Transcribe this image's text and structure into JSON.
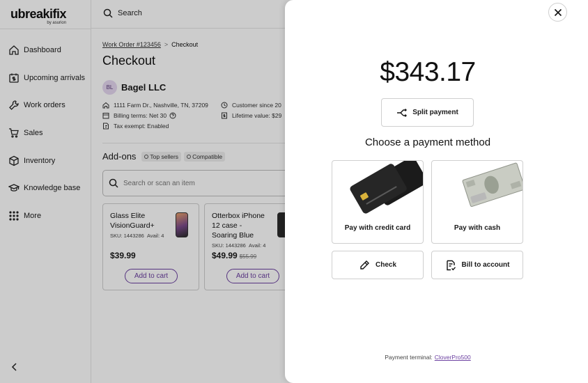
{
  "app": {
    "logo": "ubreakifix",
    "logo_sub": "by asurion",
    "search_label": "Search"
  },
  "sidebar": {
    "items": [
      {
        "label": "Dashboard",
        "icon": "home-icon"
      },
      {
        "label": "Upcoming arrivals",
        "icon": "calendar-dollar-icon"
      },
      {
        "label": "Work orders",
        "icon": "wrench-icon"
      },
      {
        "label": "Sales",
        "icon": "cart-icon"
      },
      {
        "label": "Inventory",
        "icon": "box-icon"
      },
      {
        "label": "Knowledge base",
        "icon": "graduation-cap-icon"
      },
      {
        "label": "More",
        "icon": "grid-dots-icon"
      }
    ]
  },
  "main": {
    "breadcrumb": {
      "link": "Work Order #123456",
      "separator": ">",
      "current": "Checkout"
    },
    "title": "Checkout",
    "customer": {
      "initials": "BL",
      "name": "Bagel LLC",
      "address": "1111 Farm Dr., Nashville, TN, 37209",
      "billing": "Billing terms: Net 30",
      "tax": "Tax exempt: Enabled",
      "since": "Customer since 20",
      "lifetime": "Lifetime value: $29"
    },
    "addons": {
      "title": "Add-ons",
      "chips": [
        "Top sellers",
        "Compatible"
      ],
      "search_placeholder": "Search or scan an item",
      "products": [
        {
          "name": "Glass Elite VisionGuard+",
          "sku": "SKU: 1443286",
          "avail": "Avail: 4",
          "price": "$39.99",
          "old_price": "",
          "button": "Add to cart"
        },
        {
          "name": "Otterbox iPhone 12 case - Soaring Blue",
          "sku": "SKU: 1443286",
          "avail": "Avail: 4",
          "price": "$49.99",
          "old_price": "$55.99",
          "button": "Add to cart"
        }
      ]
    }
  },
  "modal": {
    "amount": "$343.17",
    "split_label": "Split payment",
    "choose_label": "Choose a payment method",
    "methods": {
      "credit": "Pay with credit card",
      "cash": "Pay with cash",
      "check": "Check",
      "bill": "Bill to account"
    },
    "terminal_label": "Payment terminal:",
    "terminal_name": "CloverPro500"
  },
  "colors": {
    "accent": "#6b3fa0",
    "overlay": "rgba(0,0,0,0.2)"
  }
}
